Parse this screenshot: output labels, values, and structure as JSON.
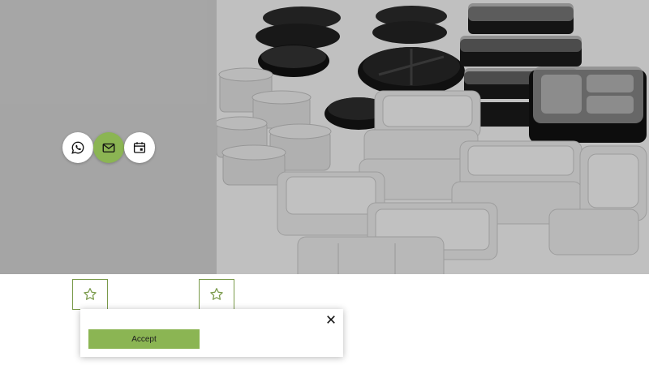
{
  "contact_bar": {
    "buttons": [
      {
        "icon": "whatsapp-icon",
        "active": false
      },
      {
        "icon": "mail-icon",
        "active": true
      },
      {
        "icon": "calendar-icon",
        "active": false
      }
    ]
  },
  "favorites": [
    {
      "icon": "star-outline-icon"
    },
    {
      "icon": "star-outline-icon"
    }
  ],
  "cookie_popup": {
    "accept_label": "Accept",
    "close_icon": "close-icon"
  },
  "colors": {
    "accent": "#8bb553",
    "hero_left": "#cfcfcf",
    "fav_border": "#7a9a4a"
  }
}
